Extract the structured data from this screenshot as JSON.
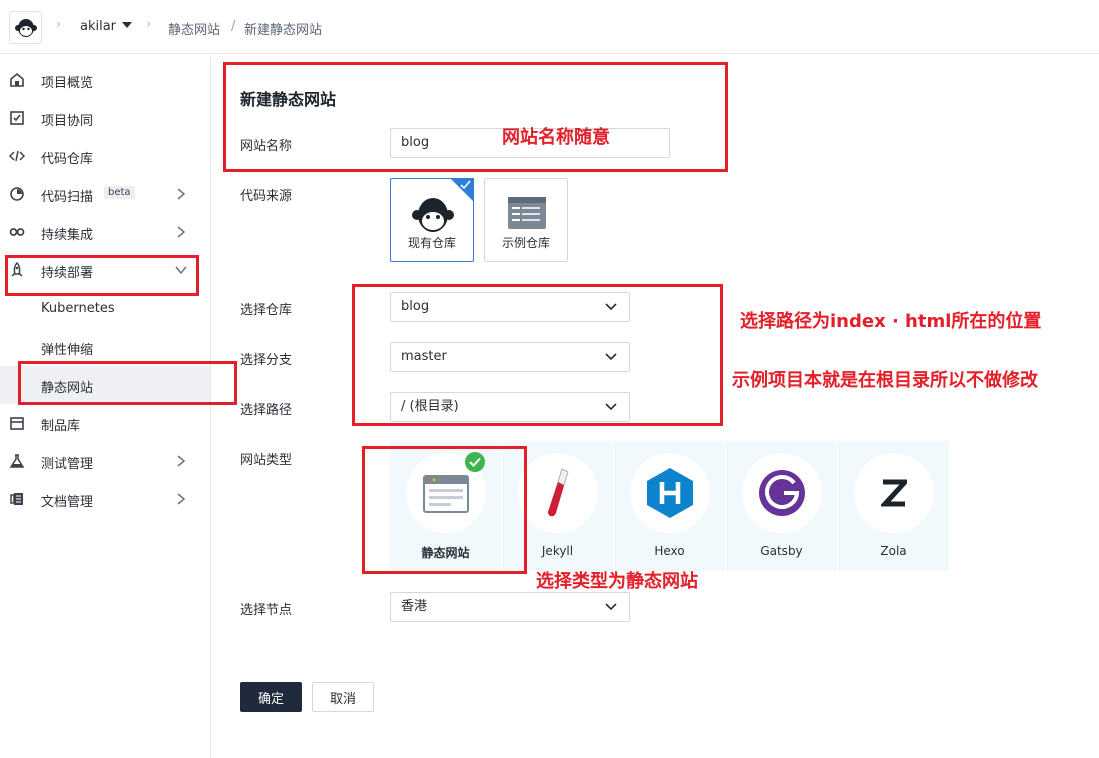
{
  "topbar": {
    "user": "akilar",
    "crumbs": [
      "静态网站",
      "新建静态网站"
    ],
    "crumb_divider": "/"
  },
  "sidebar": {
    "items": [
      {
        "label": "项目概览",
        "icon": "home-icon"
      },
      {
        "label": "项目协同",
        "icon": "checkbox-icon"
      },
      {
        "label": "代码仓库",
        "icon": "code-icon"
      },
      {
        "label": "代码扫描",
        "badge": "beta",
        "icon": "scan-icon"
      },
      {
        "label": "持续集成",
        "icon": "infinity-icon"
      },
      {
        "label": "持续部署",
        "icon": "rocket-icon"
      },
      {
        "label": "Kubernetes"
      },
      {
        "label": "弹性伸缩"
      },
      {
        "label": "静态网站"
      },
      {
        "label": "制品库",
        "icon": "package-icon"
      },
      {
        "label": "测试管理",
        "icon": "flask-icon"
      },
      {
        "label": "文档管理",
        "icon": "document-icon"
      }
    ]
  },
  "form": {
    "title": "新建静态网站",
    "site_name_label": "网站名称",
    "site_name_value": "blog",
    "source_label": "代码来源",
    "source_options": [
      "现有仓库",
      "示例仓库"
    ],
    "repo_label": "选择仓库",
    "repo_value": "blog",
    "branch_label": "选择分支",
    "branch_value": "master",
    "path_label": "选择路径",
    "path_value": "/ (根目录)",
    "type_label": "网站类型",
    "types": [
      "静态网站",
      "Jekyll",
      "Hexo",
      "Gatsby",
      "Zola"
    ],
    "node_label": "选择节点",
    "node_value": "香港",
    "confirm": "确定",
    "cancel": "取消"
  },
  "annotations": {
    "name_note": "网站名称随意",
    "path_note1": "选择路径为index · html所在的位置",
    "path_note2": "示例项目本就是在根目录所以不做修改",
    "type_note": "选择类型为静态网站"
  },
  "colors": {
    "annotation_red": "#e3202a",
    "primary_button": "#1f2a3c",
    "selected_blue": "#2e7dd6",
    "success_green": "#3eb54f"
  }
}
